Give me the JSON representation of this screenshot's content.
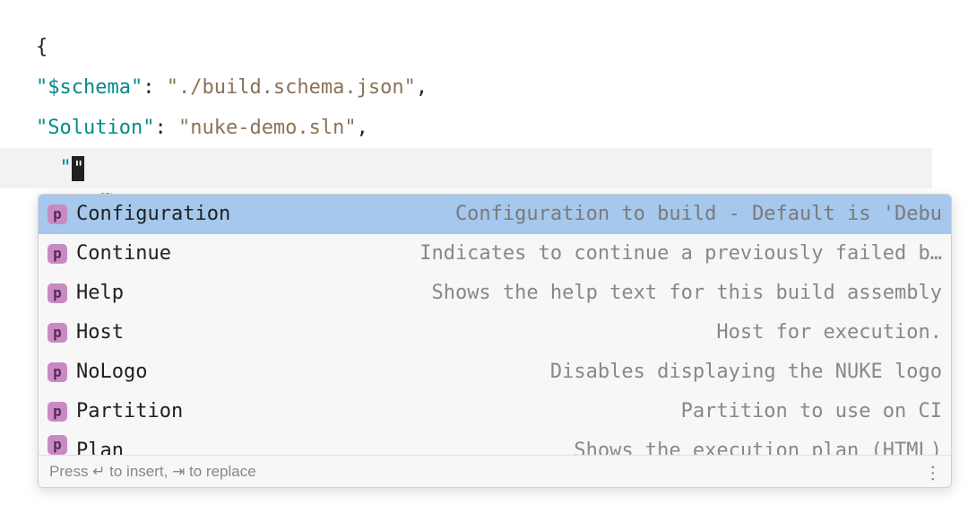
{
  "code": {
    "brace_open": "{",
    "line1_key": "$schema",
    "line1_value": "./build.schema.json",
    "line2_key": "Solution",
    "line2_value": "nuke-demo.sln",
    "line3_open_quote": "\"",
    "colon_space": ": ",
    "comma": ","
  },
  "autocomplete": {
    "items": [
      {
        "badge": "p",
        "label": "Configuration",
        "description": "Configuration to build - Default is 'Debu"
      },
      {
        "badge": "p",
        "label": "Continue",
        "description": "Indicates to continue a previously failed b…"
      },
      {
        "badge": "p",
        "label": "Help",
        "description": "Shows the help text for this build assembly"
      },
      {
        "badge": "p",
        "label": "Host",
        "description": "Host for execution."
      },
      {
        "badge": "p",
        "label": "NoLogo",
        "description": "Disables displaying the NUKE logo"
      },
      {
        "badge": "p",
        "label": "Partition",
        "description": "Partition to use on CI"
      },
      {
        "badge": "p",
        "label": "Plan",
        "description": "Shows the execution plan (HTML)"
      }
    ],
    "footer_text": "Press ↵ to insert, ⇥ to replace"
  }
}
